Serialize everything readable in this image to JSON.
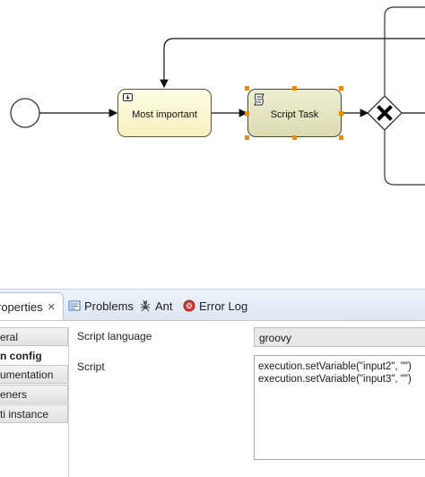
{
  "diagram": {
    "tasks": [
      {
        "label": "Most important"
      },
      {
        "label": "Script Task"
      }
    ],
    "icons": {
      "start_event": "circle-start-event-icon",
      "user_task": "user-task-icon",
      "script_task": "script-task-icon",
      "gateway": "exclusive-gateway-x-icon"
    },
    "colors": {
      "selection_handle": "#f08a00",
      "task_fill": "#f7f0bf",
      "script_task_fill": "#dcdcb0"
    }
  },
  "tabs": {
    "properties": "roperties",
    "problems": "Problems",
    "ant": "Ant",
    "error_log": "Error Log"
  },
  "nav": {
    "items": [
      "eral",
      "n config",
      "umentation",
      "eners",
      "ti instance"
    ]
  },
  "form": {
    "script_language_label": "Script language",
    "script_language_value": "groovy",
    "script_label": "Script",
    "script_value": "execution.setVariable(\"input2\", \"\")\nexecution.setVariable(\"input3\", \"\")"
  }
}
